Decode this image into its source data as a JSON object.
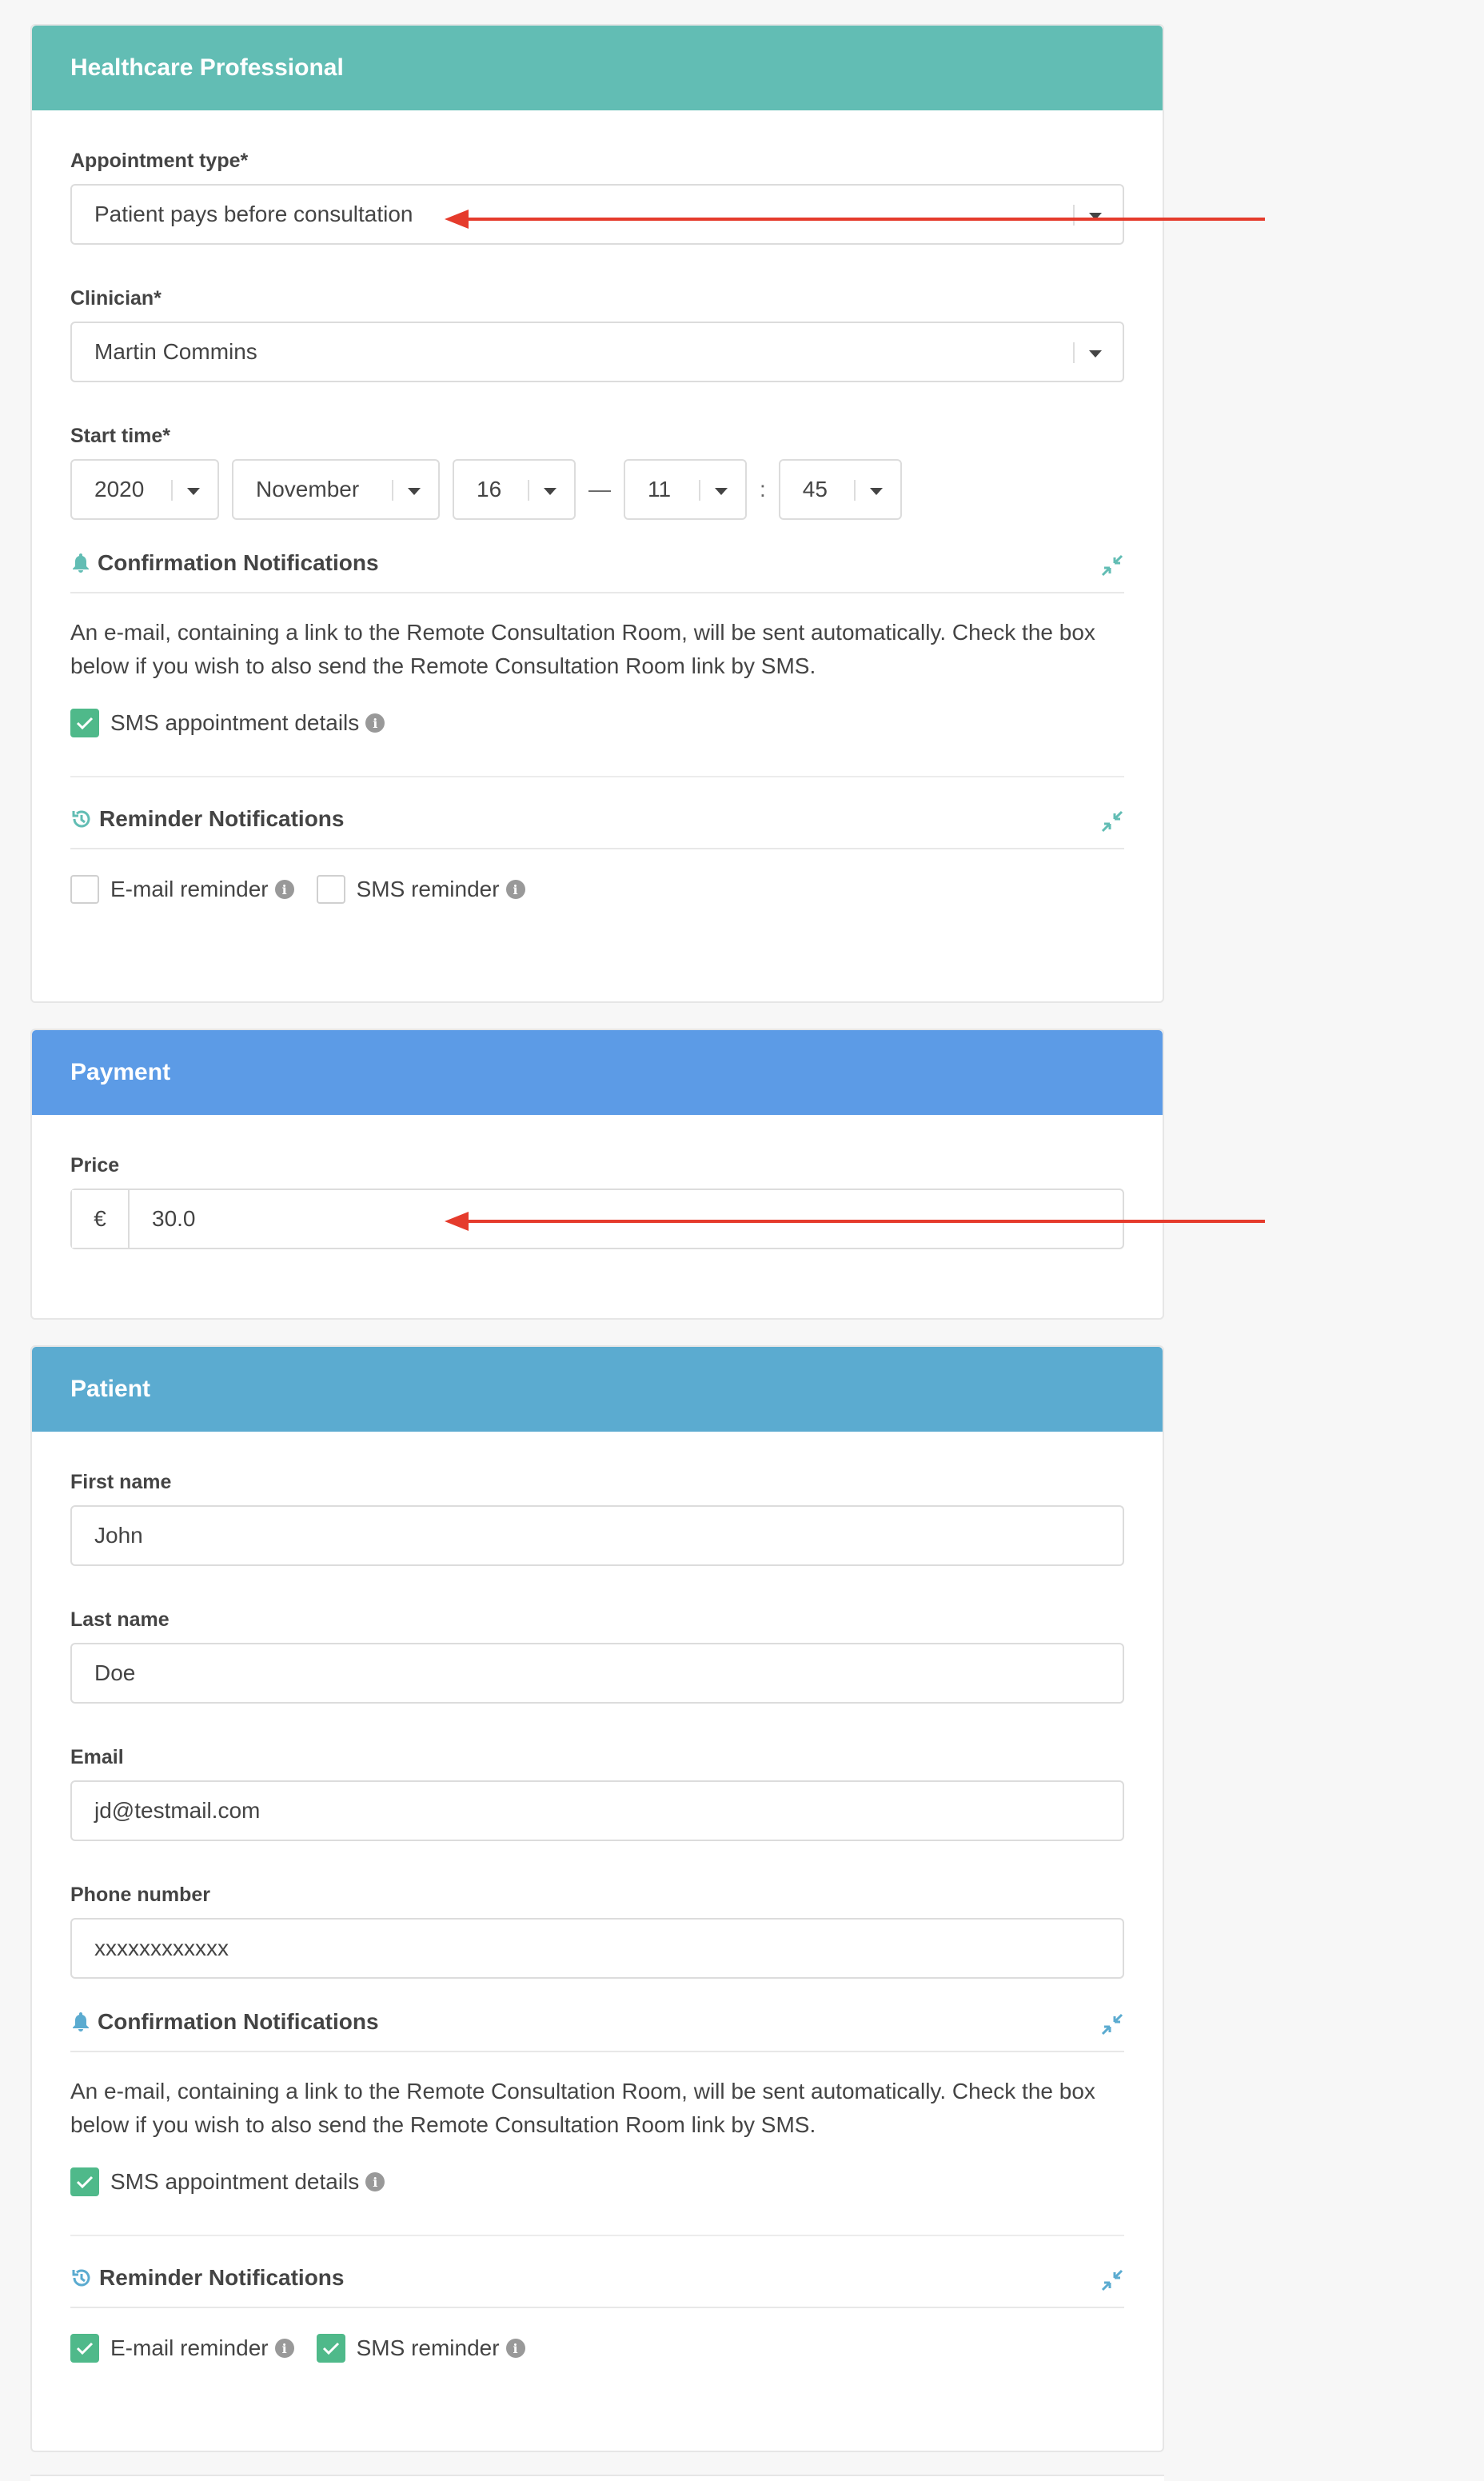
{
  "healthcare": {
    "title": "Healthcare Professional",
    "appointment_type": {
      "label": "Appointment type*",
      "value": "Patient pays before consultation"
    },
    "clinician": {
      "label": "Clinician*",
      "value": "Martin Commins"
    },
    "start_time": {
      "label": "Start time*",
      "year": "2020",
      "month": "November",
      "day": "16",
      "dash": "—",
      "hour": "11",
      "colon": ":",
      "minute": "45"
    },
    "confirmation": {
      "title": "Confirmation Notifications",
      "text": "An e-mail, containing a link to the Remote Consultation Room, will be sent automatically. Check the box below if you wish to also send the Remote Consultation Room link by SMS.",
      "sms_label": "SMS appointment details",
      "sms_checked": true
    },
    "reminder": {
      "title": "Reminder Notifications",
      "email_label": "E-mail reminder",
      "email_checked": false,
      "sms_label": "SMS reminder",
      "sms_checked": false
    }
  },
  "payment": {
    "title": "Payment",
    "price_label": "Price",
    "currency": "€",
    "price_value": "30.0"
  },
  "patient": {
    "title": "Patient",
    "first_name": {
      "label": "First name",
      "value": "John"
    },
    "last_name": {
      "label": "Last name",
      "value": "Doe"
    },
    "email": {
      "label": "Email",
      "value": "jd@testmail.com"
    },
    "phone": {
      "label": "Phone number",
      "value": "xxxxxxxxxxxx"
    },
    "confirmation": {
      "title": "Confirmation Notifications",
      "text": "An e-mail, containing a link to the Remote Consultation Room, will be sent automatically. Check the box below if you wish to also send the Remote Consultation Room link by SMS.",
      "sms_label": "SMS appointment details",
      "sms_checked": true
    },
    "reminder": {
      "title": "Reminder Notifications",
      "email_label": "E-mail reminder",
      "email_checked": true,
      "sms_label": "SMS reminder",
      "sms_checked": true
    }
  },
  "colors": {
    "teal": "#62bdb4",
    "blue": "#5c9be6",
    "sky": "#5babd0",
    "check_green": "#4fb98a",
    "arrow_red": "#e53b2c"
  },
  "icons": {
    "bell": "bell-icon",
    "history": "history-icon",
    "compress": "compress-icon",
    "info": "info-icon",
    "caret": "caret-down-icon",
    "check": "check-icon"
  }
}
